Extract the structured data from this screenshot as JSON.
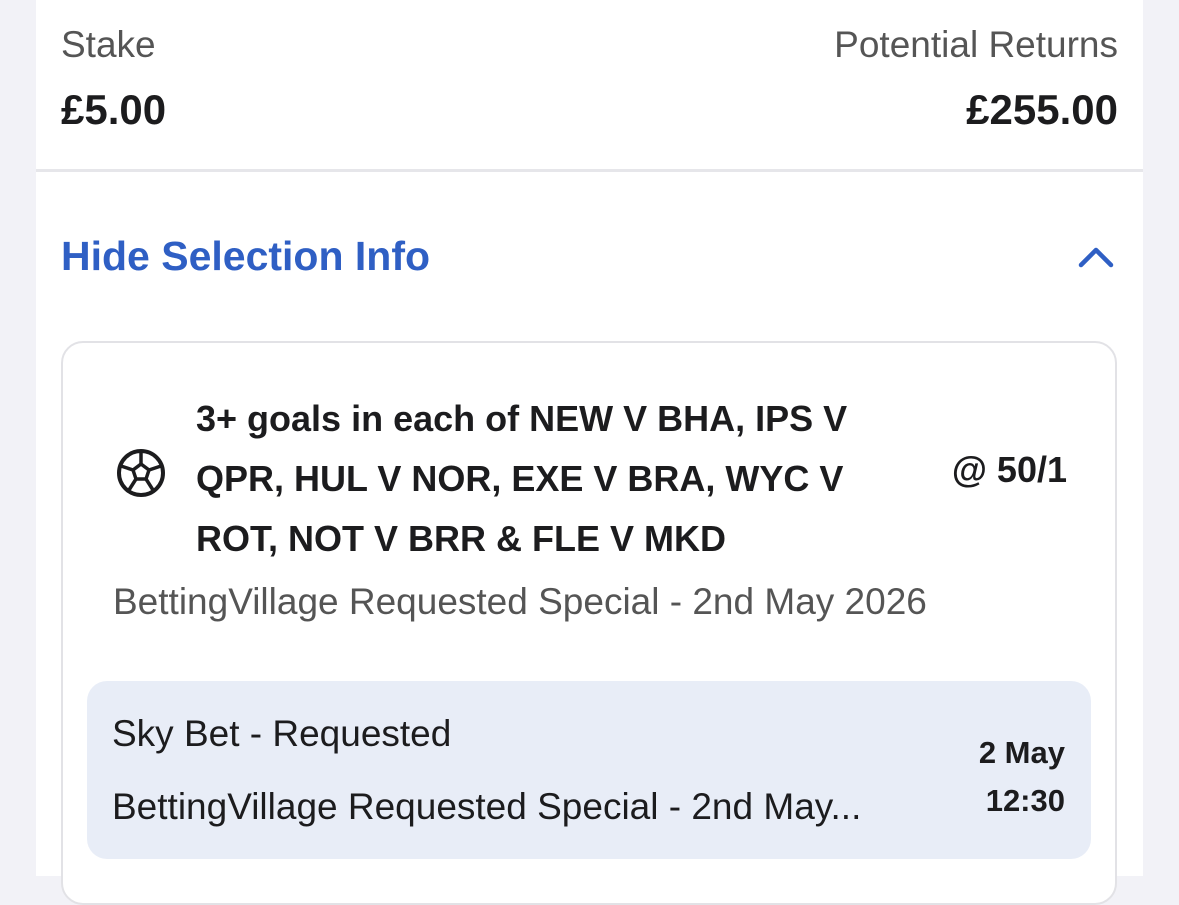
{
  "bet": {
    "stake_label": "Stake",
    "stake_value": "£5.00",
    "returns_label": "Potential Returns",
    "returns_value": "£255.00"
  },
  "toggle": {
    "label": "Hide Selection Info",
    "icon": "chevron-up-icon"
  },
  "selection": {
    "icon": "football-icon",
    "description": "3+ goals in each of NEW V BHA, IPS V QPR, HUL V NOR, EXE V BRA, WYC V ROT, NOT V BRR & FLE V MKD",
    "odds": "@ 50/1",
    "event": "BettingVillage Requested Special - 2nd May 2026"
  },
  "market_info": {
    "line1": "Sky Bet - Requested",
    "line2": "BettingVillage Requested Special - 2nd May...",
    "date": "2 May",
    "time": "12:30"
  },
  "colors": {
    "accent": "#2f5fc4",
    "info_bg": "#e8edf7"
  }
}
